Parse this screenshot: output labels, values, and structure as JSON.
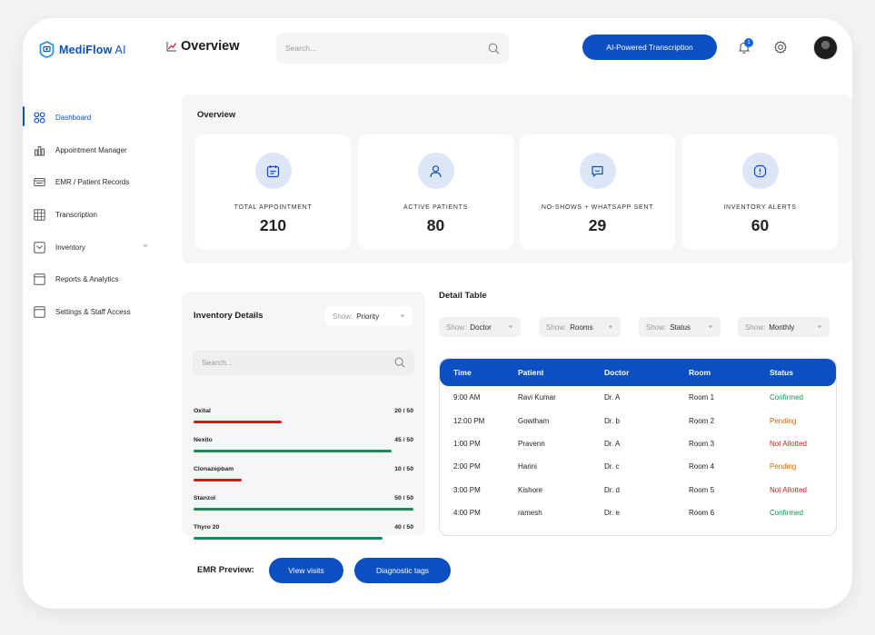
{
  "app": {
    "name": "MediFlow",
    "name_suffix": "AI"
  },
  "header": {
    "title": "Overview",
    "search_placeholder": "Search...",
    "cta_label": "AI-Powered Transcription",
    "notification_count": "1"
  },
  "sidebar": {
    "items": [
      {
        "label": "Dashboard",
        "icon": "dashboard-icon",
        "active": true
      },
      {
        "label": "Appointment Manager",
        "icon": "bar-chart-icon"
      },
      {
        "label": "EMR / Patient Records",
        "icon": "records-icon"
      },
      {
        "label": "Transcription",
        "icon": "grid-icon"
      },
      {
        "label": "Inventory",
        "icon": "inventory-icon",
        "expandable": true
      },
      {
        "label": "Reports & Analytics",
        "icon": "reports-icon"
      },
      {
        "label": "Settings & Staff Access",
        "icon": "settings-doc-icon"
      }
    ]
  },
  "overview": {
    "title": "Overview",
    "stats": [
      {
        "label": "TOTAL APPOINTMENT",
        "value": "210",
        "icon": "calendar-icon"
      },
      {
        "label": "ACTIVE PATIENTS",
        "value": "80",
        "icon": "user-icon"
      },
      {
        "label": "NO-SHOWS + WHATSAPP SENT",
        "value": "29",
        "icon": "chat-icon"
      },
      {
        "label": "INVENTORY ALERTS",
        "value": "60",
        "icon": "alert-icon"
      }
    ]
  },
  "inventory": {
    "title": "Inventory Details",
    "filter": {
      "key": "Show:",
      "value": "Priority"
    },
    "search_placeholder": "Search...",
    "items": [
      {
        "name": "Oxital",
        "qty": "20 / 50",
        "level": 0.4,
        "status": "low"
      },
      {
        "name": "Nexito",
        "qty": "45 / 50",
        "level": 0.9,
        "status": "ok"
      },
      {
        "name": "Clonazepbam",
        "qty": "10 / 50",
        "level": 0.22,
        "status": "low"
      },
      {
        "name": "Stanzol",
        "qty": "50 / 50",
        "level": 1.0,
        "status": "ok"
      },
      {
        "name": "Thyro 20",
        "qty": "40 / 50",
        "level": 0.86,
        "status": "ok"
      }
    ]
  },
  "detail_table": {
    "title": "Detail Table",
    "filters": [
      {
        "key": "Show:",
        "value": "Doctor"
      },
      {
        "key": "Show:",
        "value": "Rooms"
      },
      {
        "key": "Show:",
        "value": "Status"
      },
      {
        "key": "Show:",
        "value": "Monthly"
      }
    ],
    "columns": [
      "Time",
      "Patient",
      "Doctor",
      "Room",
      "Status"
    ],
    "rows": [
      {
        "time": "9:00 AM",
        "patient": "Ravi Kumar",
        "doctor": "Dr. A",
        "room": "Room 1",
        "status": "Confirmed"
      },
      {
        "time": "12:00 PM",
        "patient": "Gowtham",
        "doctor": "Dr. b",
        "room": "Room 2",
        "status": "Pending"
      },
      {
        "time": "1:00 PM",
        "patient": "Pravenn",
        "doctor": "Dr. A",
        "room": "Room 3",
        "status": "Not Allotted"
      },
      {
        "time": "2:00 PM",
        "patient": "Harini",
        "doctor": "Dr. c",
        "room": "Room 4",
        "status": "Pending"
      },
      {
        "time": "3:00 PM",
        "patient": "Kishore",
        "doctor": "Dr. d",
        "room": "Room 5",
        "status": "Not Allotted"
      },
      {
        "time": "4:00 PM",
        "patient": "ramesh",
        "doctor": "Dr. e",
        "room": "Room 6",
        "status": "Confirmed"
      }
    ]
  },
  "emr": {
    "label": "EMR Preview:",
    "buttons": [
      "View visits",
      "Diagnostic tags"
    ]
  },
  "colors": {
    "accent": "#0b4fc2",
    "bar_low": "#d9161d",
    "bar_ok": "#0d8f55",
    "status_confirmed": "#0d9a50",
    "status_pending": "#d26a00",
    "status_not_allotted": "#d9161d"
  }
}
